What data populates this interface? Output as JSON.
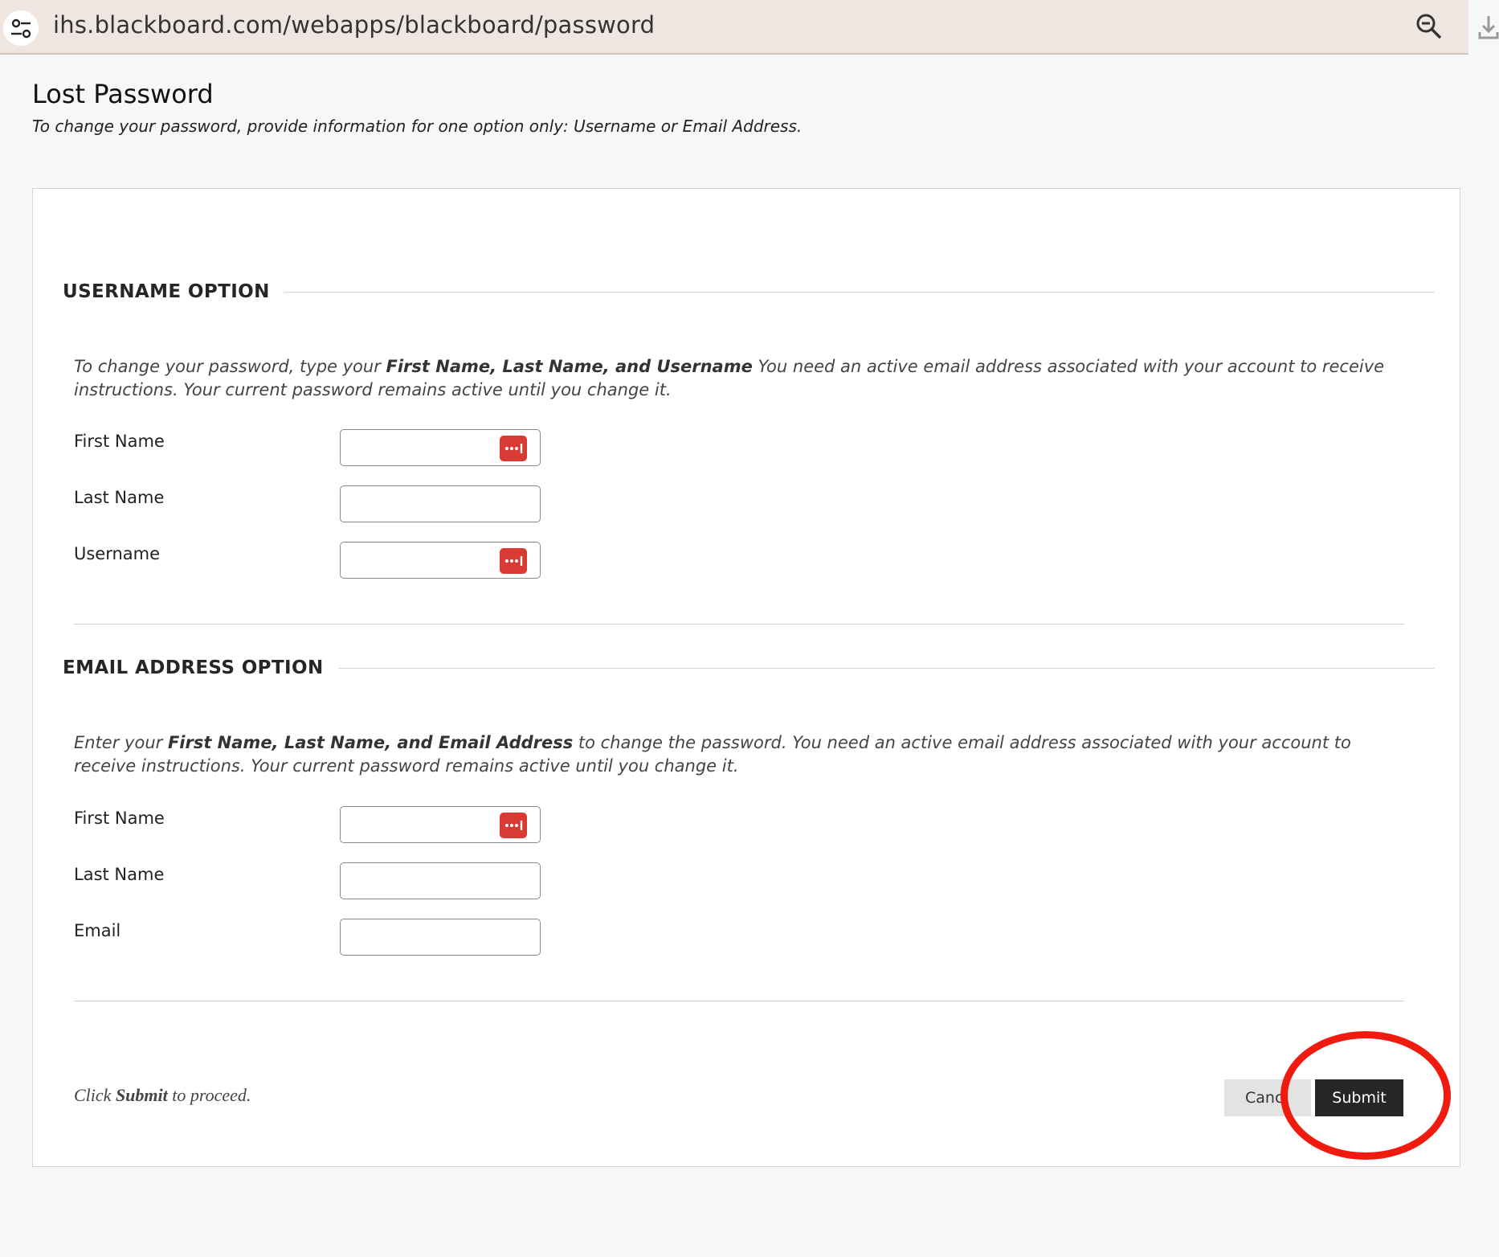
{
  "browser": {
    "url": "ihs.blackboard.com/webapps/blackboard/password"
  },
  "page": {
    "title": "Lost Password",
    "subtitle": "To change your password, provide information for one option only: Username or Email Address."
  },
  "username_option": {
    "heading": "USERNAME OPTION",
    "instr_pre": "To change your password, type your ",
    "instr_bold": "First Name, Last Name, and Username",
    "instr_post": " You need an active email address associated with your account to receive instructions. Your current password remains active until you change it.",
    "fields": [
      {
        "label": "First Name",
        "value": ""
      },
      {
        "label": "Last Name",
        "value": ""
      },
      {
        "label": "Username",
        "value": ""
      }
    ]
  },
  "email_option": {
    "heading": "EMAIL ADDRESS OPTION",
    "instr_pre": "Enter your ",
    "instr_bold": "First Name, Last Name, and Email Address",
    "instr_post": " to change the password. You need an active email address associated with your account to receive instructions. Your current password remains active until you change it.",
    "fields": [
      {
        "label": "First Name",
        "value": ""
      },
      {
        "label": "Last Name",
        "value": ""
      },
      {
        "label": "Email",
        "value": ""
      }
    ]
  },
  "footer": {
    "proceed_pre": "Click ",
    "proceed_bold": "Submit",
    "proceed_post": " to proceed.",
    "cancel_label": "Canc",
    "submit_label": "Submit"
  },
  "colors": {
    "password_manager_icon": "#d93a33",
    "highlight": "#f01a0e",
    "submit_bg": "#262626"
  }
}
